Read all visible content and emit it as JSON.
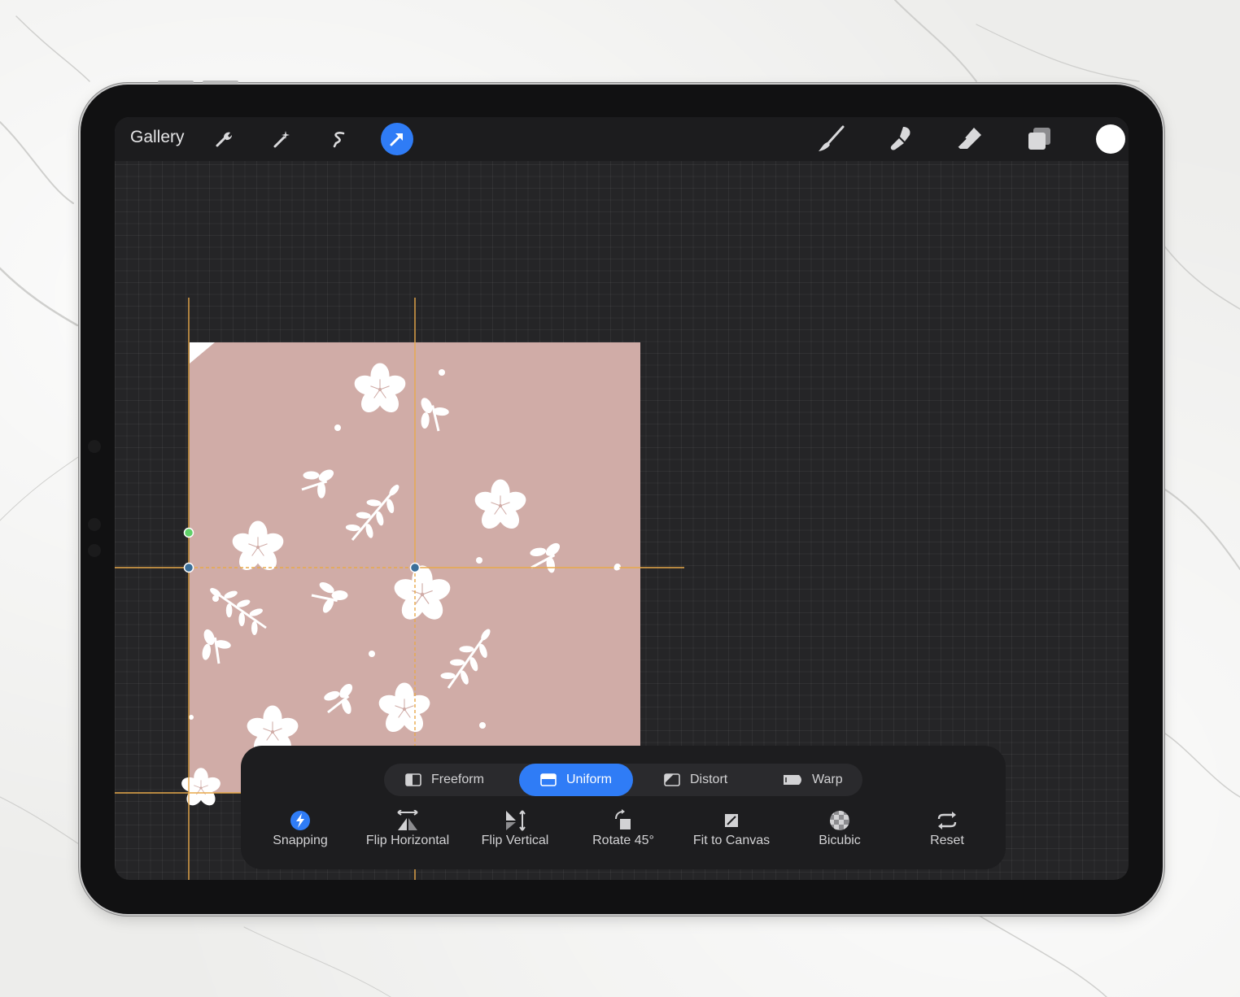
{
  "topbar": {
    "gallery_label": "Gallery",
    "left_tools": [
      "wrench-icon",
      "magic-wand-icon",
      "selection-icon",
      "transform-icon"
    ],
    "active_tool": "transform-icon",
    "right_tools": [
      "brush-icon",
      "smudge-icon",
      "eraser-icon",
      "layers-icon"
    ],
    "current_color": "#ffffff"
  },
  "canvas": {
    "background_color": "#d0aca7",
    "pattern_color": "#ffffff",
    "guide_color": "#e8a94a",
    "handle_color": "#3a7bd5",
    "rotate_handle_color": "#5fd068"
  },
  "transform_modes": {
    "items": [
      {
        "label": "Freeform",
        "icon": "freeform-icon"
      },
      {
        "label": "Uniform",
        "icon": "uniform-icon"
      },
      {
        "label": "Distort",
        "icon": "distort-icon"
      },
      {
        "label": "Warp",
        "icon": "warp-icon"
      }
    ],
    "selected": "Uniform"
  },
  "transform_actions": [
    {
      "label": "Snapping",
      "icon": "snapping-icon",
      "active": true
    },
    {
      "label": "Flip Horizontal",
      "icon": "flip-horizontal-icon"
    },
    {
      "label": "Flip Vertical",
      "icon": "flip-vertical-icon"
    },
    {
      "label": "Rotate 45°",
      "icon": "rotate-icon"
    },
    {
      "label": "Fit to Canvas",
      "icon": "fit-to-canvas-icon"
    },
    {
      "label": "Bicubic",
      "icon": "bicubic-icon"
    },
    {
      "label": "Reset",
      "icon": "reset-icon"
    }
  ],
  "colors": {
    "accent": "#2f7cf6",
    "toolbar_bg": "#1c1c1e",
    "panel_bg": "#1d1d1f"
  }
}
